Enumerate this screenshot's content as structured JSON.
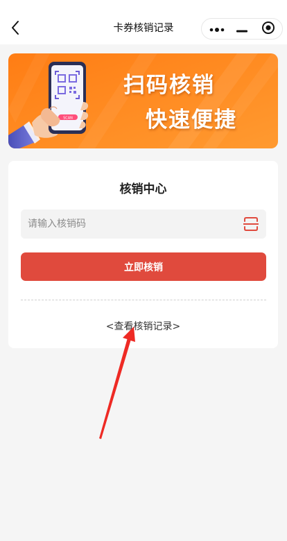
{
  "navbar": {
    "title": "卡券核销记录",
    "back_icon": "chevron-left-icon",
    "more_icon": "more-dots-icon",
    "minimize_icon": "minimize-icon",
    "close_icon": "target-close-icon"
  },
  "banner": {
    "line1": "扫码核销",
    "line2": "快速便捷",
    "phone_badge": "SCAN",
    "background_color": "#ff8a1f"
  },
  "card": {
    "title": "核销中心",
    "input": {
      "value": "",
      "placeholder": "请输入核销码"
    },
    "scan_icon": "scan-icon",
    "submit_label": "立即核销",
    "records_link": "<查看核销记录>"
  },
  "colors": {
    "accent": "#e04a3d",
    "page_bg": "#f5f5f5",
    "annotation_arrow": "#ee2a24"
  }
}
